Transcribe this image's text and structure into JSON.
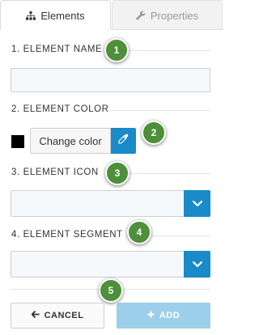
{
  "tabs": [
    {
      "label": "Elements",
      "icon": "sitemap-icon",
      "active": true
    },
    {
      "label": "Properties",
      "icon": "wrench-icon",
      "active": false
    }
  ],
  "sections": {
    "name": {
      "label": "1. ELEMENT NAME",
      "value": "",
      "placeholder": ""
    },
    "color": {
      "label": "2. ELEMENT COLOR",
      "swatch_color": "#000000",
      "button_label": "Change color",
      "picker_icon": "eyedropper-icon"
    },
    "icon": {
      "label": "3. ELEMENT ICON",
      "selected": ""
    },
    "segment": {
      "label": "4. ELEMENT SEGMENT",
      "selected": ""
    }
  },
  "badges": [
    "1",
    "2",
    "3",
    "4",
    "5"
  ],
  "actions": {
    "cancel_label": "CANCEL",
    "add_label": "ADD"
  },
  "colors": {
    "accent": "#1a8ac8",
    "accent_disabled": "#9ccfe9",
    "badge": "#4e8f3a"
  }
}
